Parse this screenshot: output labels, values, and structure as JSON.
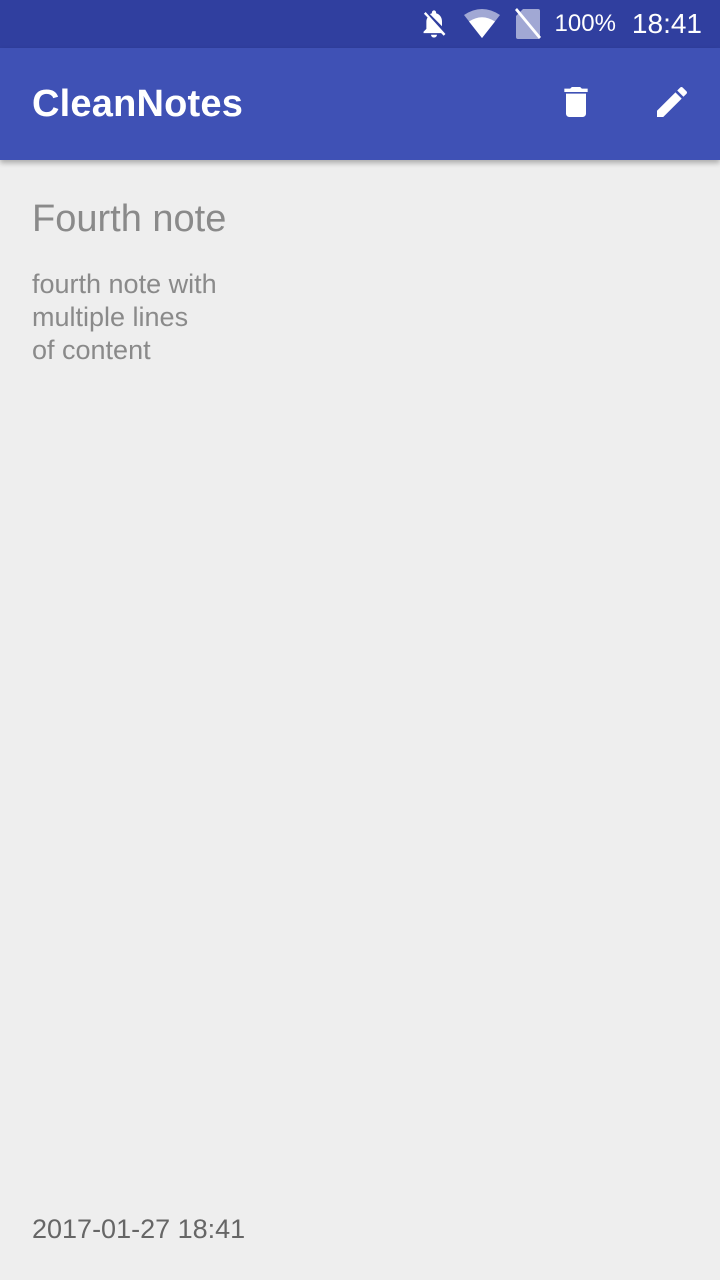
{
  "status_bar": {
    "icons": [
      "notifications-off-icon",
      "wifi-icon",
      "no-sim-icon"
    ],
    "battery": "100%",
    "time": "18:41",
    "color": "#303f9f"
  },
  "app_bar": {
    "title": "CleanNotes",
    "color": "#3f51b5",
    "actions": [
      "delete-icon",
      "edit-icon"
    ]
  },
  "note": {
    "title": "Fourth note",
    "content": "fourth note with\nmultiple lines\nof content",
    "date": "2017-01-27 18:41"
  }
}
